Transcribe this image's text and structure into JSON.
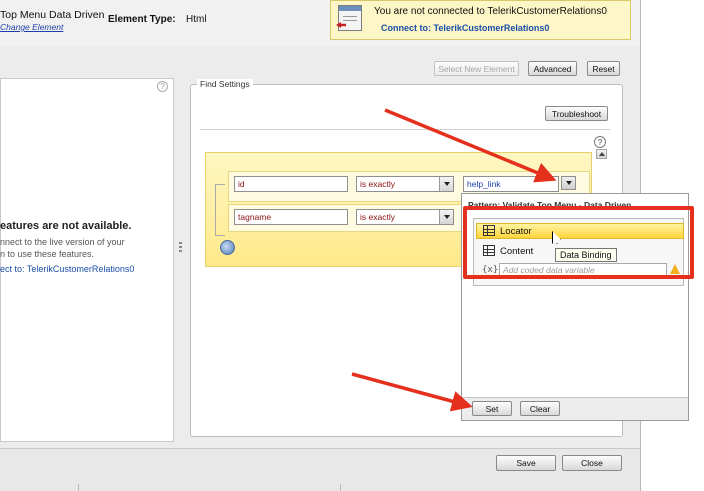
{
  "header": {
    "title": "Top Menu Data Driven",
    "change_link": "Change Element",
    "element_type_label": "Element Type:",
    "element_type_value": "Html"
  },
  "connection": {
    "message": "You are not connected to TelerikCustomerRelations0",
    "connect_link": "Connect to: TelerikCustomerRelations0"
  },
  "toolbar": {
    "select_new": "Select New Element",
    "advanced": "Advanced",
    "reset": "Reset"
  },
  "left_panel": {
    "heading": "eatures are not available.",
    "line1": "nnect to the live version of your",
    "line2": "n to use these features.",
    "connect": "ect to: TelerikCustomerRelations0",
    "help": "?"
  },
  "find_settings": {
    "legend": "Find Settings",
    "troubleshoot": "Troubleshoot",
    "help": "?",
    "rows": [
      {
        "attribute": "id",
        "operator": "is exactly",
        "value": "help_link"
      },
      {
        "attribute": "tagname",
        "operator": "is exactly",
        "value": ""
      }
    ]
  },
  "popup": {
    "header": "Pattern: Validate Top Menu - Data Driven",
    "items": [
      {
        "label": "Locator",
        "icon": "grid-icon"
      },
      {
        "label": "Content",
        "icon": "grid-icon"
      }
    ],
    "tooltip": "Data Binding",
    "coded_placeholder": "Add coded data variable",
    "set": "Set",
    "clear": "Clear"
  },
  "footer": {
    "save": "Save",
    "close": "Close"
  },
  "colors": {
    "annotation": "#e5301d",
    "highlight": "#ffe14f",
    "panel_yellow": "#fff3b0"
  }
}
